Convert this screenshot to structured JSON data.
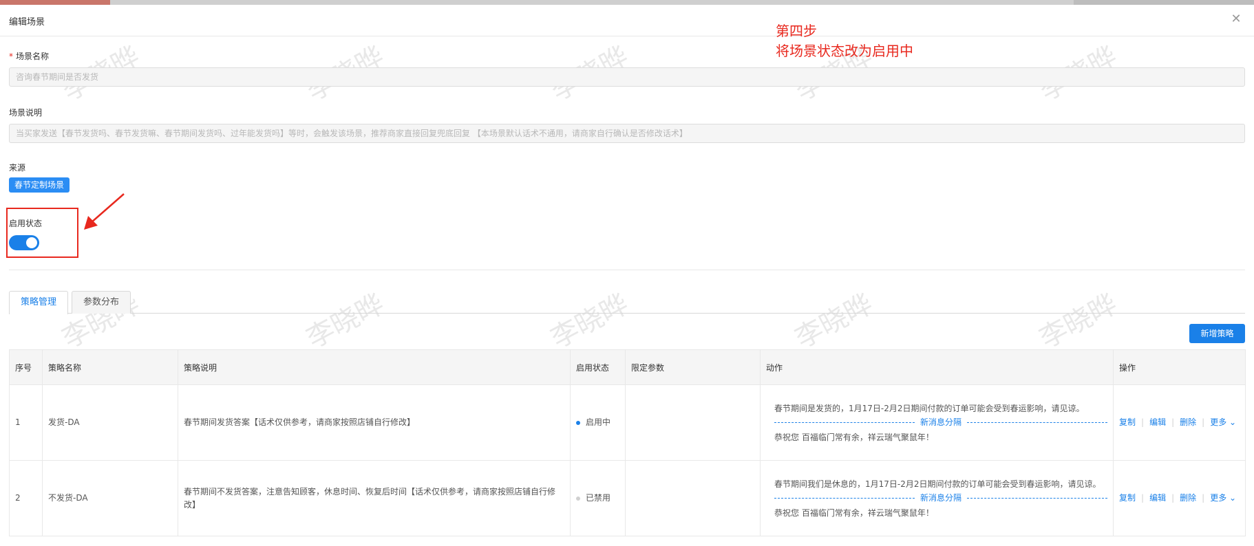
{
  "dialog": {
    "title": "编辑场景",
    "close_icon": "close-icon"
  },
  "annotation": {
    "step": "第四步",
    "text": "将场景状态改为启用中"
  },
  "form": {
    "name_label": "场景名称",
    "name_value": "咨询春节期间是否发货",
    "desc_label": "场景说明",
    "desc_value": "当买家发送【春节发货吗、春节发货嘛、春节期间发货吗、过年能发货吗】等时，会触发该场景，推荐商家直接回复兜底回复 【本场景默认话术不通用，请商家自行确认是否修改话术】",
    "source_label": "来源",
    "source_tag": "春节定制场景",
    "status_label": "启用状态",
    "status_on": true
  },
  "tabs": [
    {
      "label": "策略管理",
      "active": true
    },
    {
      "label": "参数分布",
      "active": false
    }
  ],
  "add_button": "新增策略",
  "table": {
    "headers": [
      "序号",
      "策略名称",
      "策略说明",
      "启用状态",
      "限定参数",
      "动作",
      "操作"
    ],
    "rows": [
      {
        "index": "1",
        "name": "发货-DA",
        "desc": "春节期间发货答案【话术仅供参考，请商家按照店铺自行修改】",
        "status": "启用中",
        "status_color": "#1a80e8",
        "params": "",
        "action_line1": "春节期间是发货的，1月17日-2月2日期间付款的订单可能会受到春运影响，请见谅。",
        "separator": "新消息分隔",
        "action_line2": "恭祝您 百福临门常有余，祥云瑞气聚鼠年！"
      },
      {
        "index": "2",
        "name": "不发货-DA",
        "desc": "春节期间不发货答案，注意告知顾客，休息时间、恢复后时间【话术仅供参考，请商家按照店铺自行修改】",
        "status": "已禁用",
        "status_color": "#d0d0d0",
        "params": "",
        "action_line1": "春节期间我们是休息的，1月17日-2月2日期间付款的订单可能会受到春运影响，请见谅。",
        "separator": "新消息分隔",
        "action_line2": "恭祝您 百福临门常有余，祥云瑞气聚鼠年！"
      }
    ],
    "ops": [
      "复制",
      "编辑",
      "删除",
      "更多"
    ]
  },
  "watermark": "李晓晔",
  "colors": {
    "primary": "#1a80e8",
    "annotation": "#e8281e"
  }
}
